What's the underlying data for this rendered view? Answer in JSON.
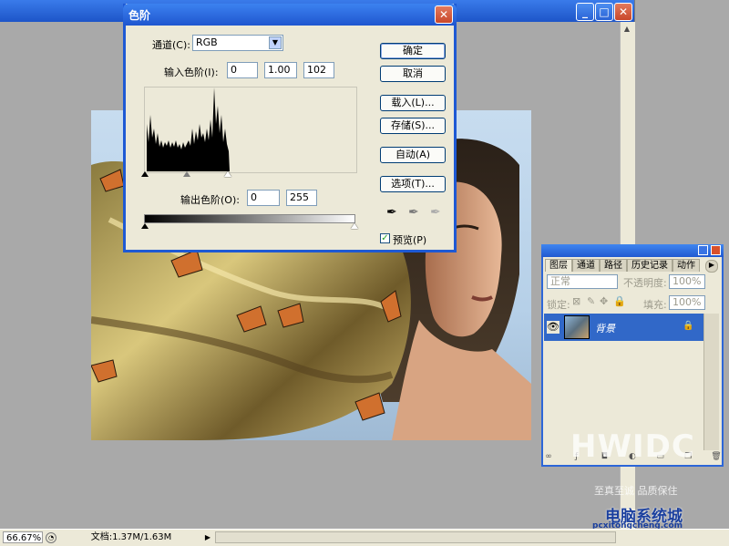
{
  "document": {
    "photo_alt": "",
    "zoom": "66.67%",
    "doc_size": "文档:1.37M/1.63M"
  },
  "levels_dialog": {
    "title": "色阶",
    "channel_label": "通道(C):",
    "channel_value": "RGB",
    "input_label": "输入色阶(I):",
    "input_black": "0",
    "input_gamma": "1.00",
    "input_white": "102",
    "output_label": "输出色阶(O):",
    "output_black": "0",
    "output_white": "255",
    "buttons": {
      "ok": "确定",
      "cancel": "取消",
      "load": "载入(L)...",
      "save": "存储(S)...",
      "auto": "自动(A)",
      "options": "选项(T)..."
    },
    "preview_label": "预览(P)",
    "preview_checked": true
  },
  "layers_panel": {
    "tabs": [
      "图层",
      "通道",
      "路径",
      "历史记录",
      "动作"
    ],
    "blend_mode": "正常",
    "opacity_label": "不透明度:",
    "opacity_value": "100%",
    "lock_label": "锁定:",
    "fill_label": "填充:",
    "fill_value": "100%",
    "layer_name": "背景"
  },
  "watermark": {
    "brand": "HWIDC",
    "slogan": "至真至诚 品质保住",
    "site": "电脑系统城",
    "url": "pcxitongcheng.com"
  },
  "colors": {
    "xp_blue": "#1e59d4",
    "selection_blue": "#3168c8",
    "dialog_bg": "#ece9d8"
  }
}
